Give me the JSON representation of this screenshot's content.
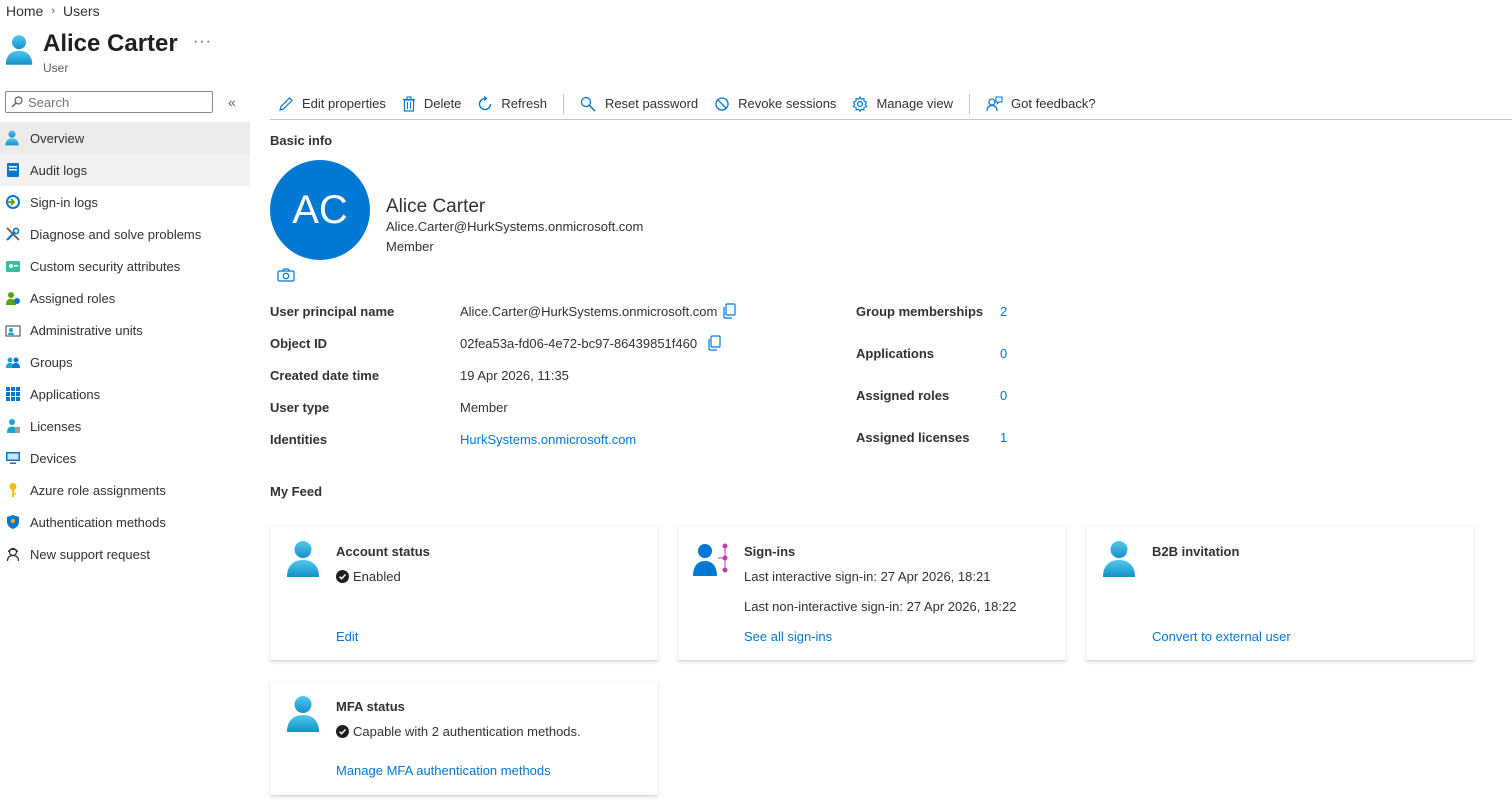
{
  "breadcrumb": [
    "Home",
    "Users"
  ],
  "header": {
    "title": "Alice Carter",
    "subtitle": "User",
    "more": "···"
  },
  "sidebar": {
    "search_placeholder": "Search",
    "collapse": "«",
    "items": [
      {
        "label": "Overview",
        "icon": "user-icon"
      },
      {
        "label": "Audit logs",
        "icon": "audit-log-icon"
      },
      {
        "label": "Sign-in logs",
        "icon": "sign-in-icon"
      },
      {
        "label": "Diagnose and solve problems",
        "icon": "wrench-icon"
      },
      {
        "label": "Custom security attributes",
        "icon": "security-attributes-icon"
      },
      {
        "label": "Assigned roles",
        "icon": "roles-icon"
      },
      {
        "label": "Administrative units",
        "icon": "admin-units-icon"
      },
      {
        "label": "Groups",
        "icon": "groups-icon"
      },
      {
        "label": "Applications",
        "icon": "apps-grid-icon"
      },
      {
        "label": "Licenses",
        "icon": "license-icon"
      },
      {
        "label": "Devices",
        "icon": "device-icon"
      },
      {
        "label": "Azure role assignments",
        "icon": "key-icon"
      },
      {
        "label": "Authentication methods",
        "icon": "shield-icon"
      },
      {
        "label": "New support request",
        "icon": "support-icon"
      }
    ]
  },
  "toolbar": {
    "edit": "Edit properties",
    "delete": "Delete",
    "refresh": "Refresh",
    "reset_password": "Reset password",
    "revoke_sessions": "Revoke sessions",
    "manage_view": "Manage view",
    "feedback": "Got feedback?"
  },
  "basic_info": {
    "title": "Basic info",
    "initials": "AC",
    "name": "Alice Carter",
    "email": "Alice.Carter@HurkSystems.onmicrosoft.com",
    "member": "Member"
  },
  "properties": {
    "upn_label": "User principal name",
    "upn_value": "Alice.Carter@HurkSystems.onmicrosoft.com",
    "object_id_label": "Object ID",
    "object_id_value": "02fea53a-fd06-4e72-bc97-86439851f460",
    "created_label": "Created date time",
    "created_value": "19 Apr 2026, 11:35",
    "user_type_label": "User type",
    "user_type_value": "Member",
    "identities_label": "Identities",
    "identities_value": "HurkSystems.onmicrosoft.com"
  },
  "stats": {
    "groups_label": "Group memberships",
    "groups_value": "2",
    "apps_label": "Applications",
    "apps_value": "0",
    "roles_label": "Assigned roles",
    "roles_value": "0",
    "licenses_label": "Assigned licenses",
    "licenses_value": "1"
  },
  "feed": {
    "title": "My Feed",
    "account": {
      "title": "Account status",
      "status": "Enabled",
      "link": "Edit"
    },
    "signins": {
      "title": "Sign-ins",
      "interactive": "Last interactive sign-in: 27 Apr 2026, 18:21",
      "noninteractive": "Last non-interactive sign-in: 27 Apr 2026, 18:22",
      "link": "See all sign-ins"
    },
    "b2b": {
      "title": "B2B invitation",
      "link": "Convert to external user"
    },
    "mfa": {
      "title": "MFA status",
      "status": "Capable with 2 authentication methods.",
      "link": "Manage MFA authentication methods"
    }
  },
  "colors": {
    "accent": "#0078d4",
    "avatar_bg": "#0078d4",
    "user_icon": "#1aa4d4",
    "nav_active": "#edebe9"
  }
}
